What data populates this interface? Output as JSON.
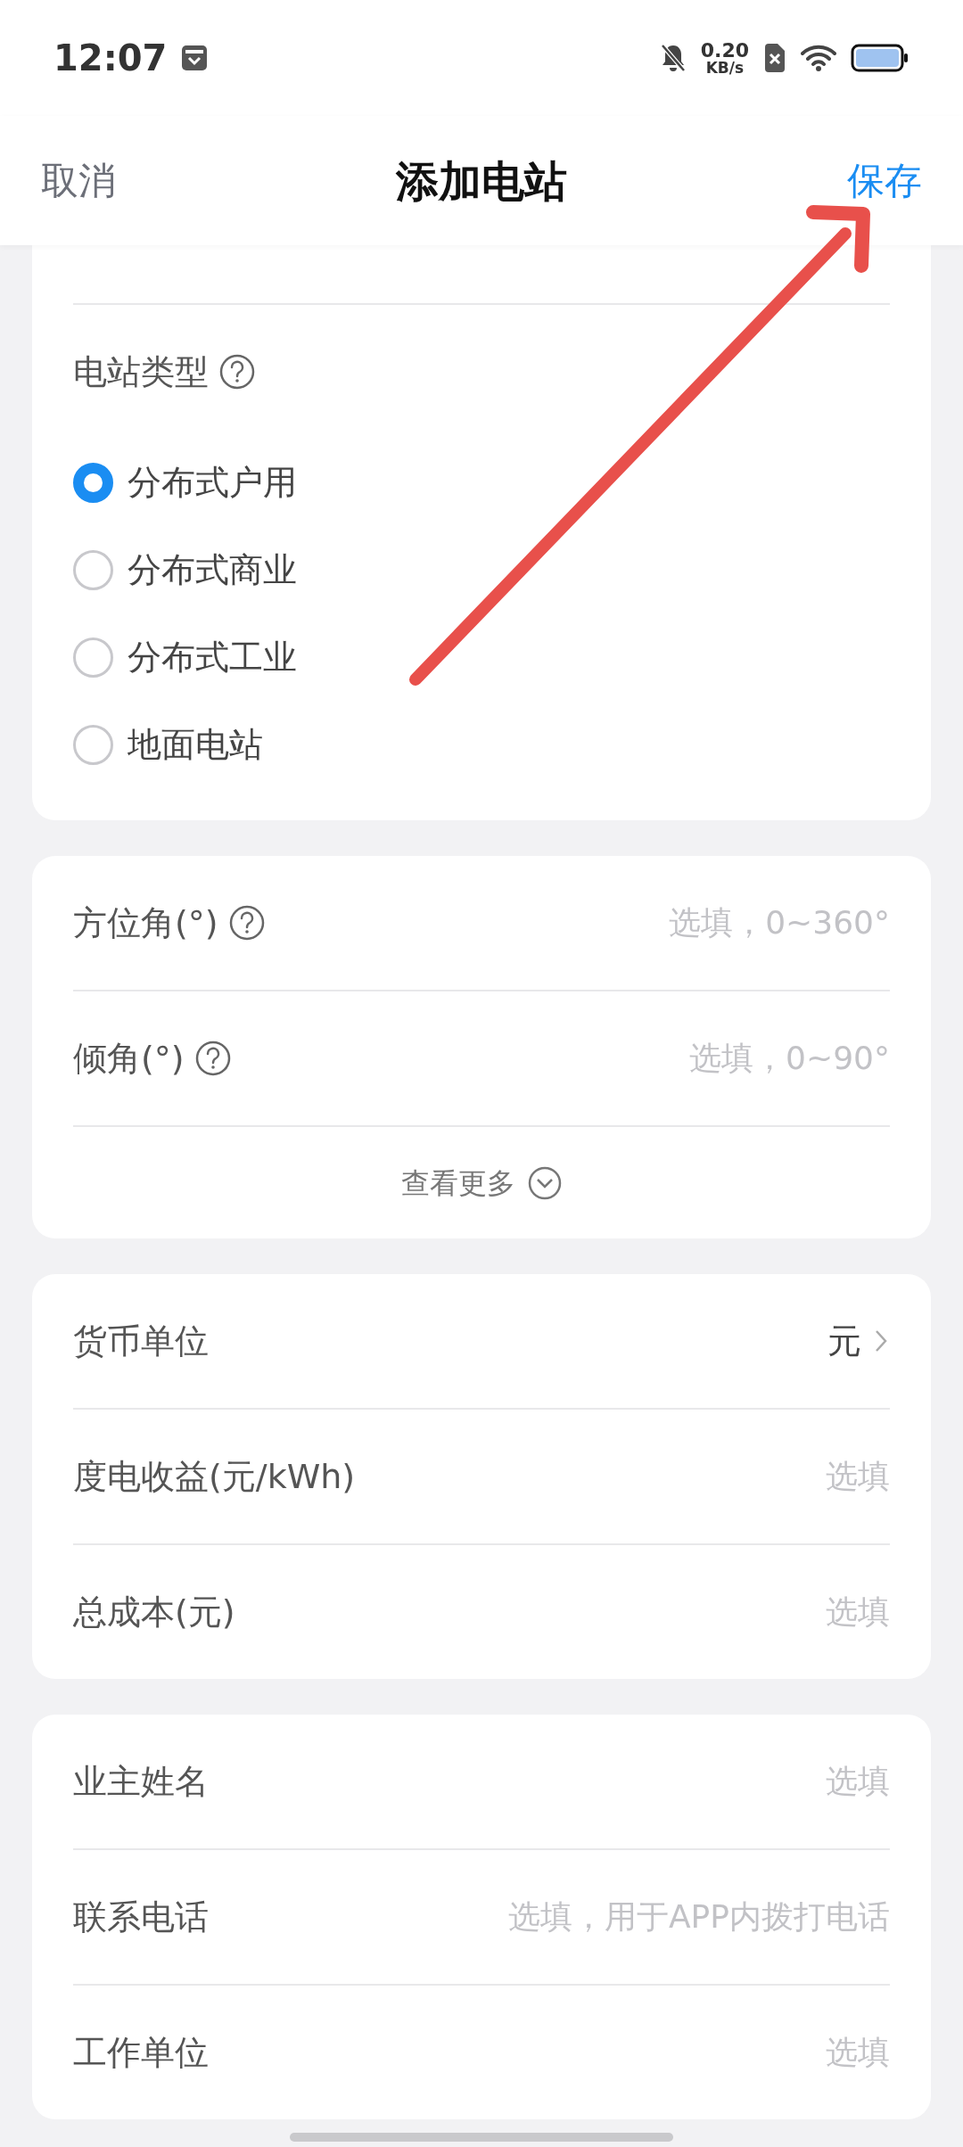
{
  "status_bar": {
    "time": "12:07",
    "speed_value": "0.20",
    "speed_unit": "KB/s"
  },
  "header": {
    "cancel": "取消",
    "title": "添加电站",
    "save": "保存"
  },
  "station_type": {
    "label": "电站类型",
    "help": true,
    "options": [
      {
        "label": "分布式户用",
        "selected": true
      },
      {
        "label": "分布式商业",
        "selected": false
      },
      {
        "label": "分布式工业",
        "selected": false
      },
      {
        "label": "地面电站",
        "selected": false
      }
    ]
  },
  "angles": {
    "fields": [
      {
        "kind": "input",
        "label": "方位角(°)",
        "help": true,
        "placeholder": "选填，0~360°"
      },
      {
        "kind": "input",
        "label": "倾角(°)",
        "help": true,
        "placeholder": "选填，0~90°"
      }
    ],
    "more": "查看更多"
  },
  "finance": [
    {
      "kind": "select",
      "label": "货币单位",
      "value": "元"
    },
    {
      "kind": "input",
      "label": "度电收益(元/kWh)",
      "placeholder": "选填"
    },
    {
      "kind": "input",
      "label": "总成本(元)",
      "placeholder": "选填"
    }
  ],
  "owner": [
    {
      "kind": "input",
      "label": "业主姓名",
      "placeholder": "选填"
    },
    {
      "kind": "input",
      "label": "联系电话",
      "placeholder": "选填，用于APP内拨打电话"
    },
    {
      "kind": "input",
      "label": "工作单位",
      "placeholder": "选填"
    }
  ]
}
